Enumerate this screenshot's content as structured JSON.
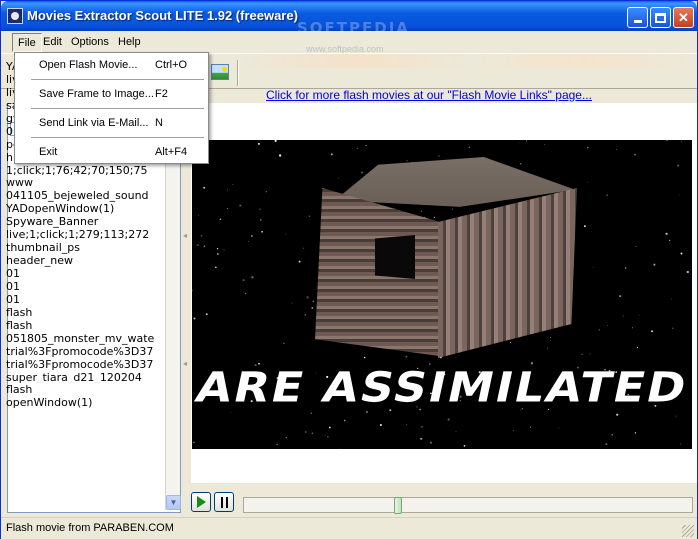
{
  "window": {
    "title": "Movies Extractor Scout LITE 1.92 (freeware)",
    "watermark": "SOFTPEDIA",
    "watermark_small": "www.softpedia.com"
  },
  "menubar": {
    "items": [
      "File",
      "Edit",
      "Options",
      "Help"
    ]
  },
  "file_menu": {
    "items": [
      {
        "label": "Open Flash Movie...",
        "shortcut": "Ctrl+O"
      },
      {
        "label": "Save Frame to Image...",
        "shortcut": "F2"
      },
      {
        "label": "Send Link via E-Mail...",
        "shortcut": "N"
      },
      {
        "label": "Exit",
        "shortcut": "Alt+F4"
      }
    ]
  },
  "link_bar": {
    "text": "Click for more flash movies at our \"Flash Movie Links\" page..."
  },
  "movie_list": {
    "items": [
      "YADopenWindow(1)",
      "live;1;click;1;279;113;263",
      "live;1;click;1;279;113;271",
      "sample",
      "gf7_main",
      "01",
      "pg-02",
      "hp_flash",
      "1;click;1;76;42;70;150;75",
      "www",
      "041105_bejeweled_sound",
      "YADopenWindow(1)",
      "Spyware_Banner",
      "live;1;click;1;279;113;272",
      "thumbnail_ps",
      "header_new",
      "01",
      "01",
      "01",
      "flash",
      "flash",
      "051805_monster_mv_wate",
      "trial%3Fpromocode%3D37",
      "trial%3Fpromocode%3D37",
      "super_tiara_d21_120204",
      "flash",
      "openWindow(1)"
    ]
  },
  "movie": {
    "caption": "ARE ASSIMILATED"
  },
  "player": {
    "seek_position": 0.34
  },
  "status": {
    "text": "Flash movie from PARABEN.COM"
  },
  "colors": {
    "titlebar": "#0553d9",
    "link": "#0000ee",
    "chrome": "#ece9d8",
    "play_green": "#148f14"
  }
}
